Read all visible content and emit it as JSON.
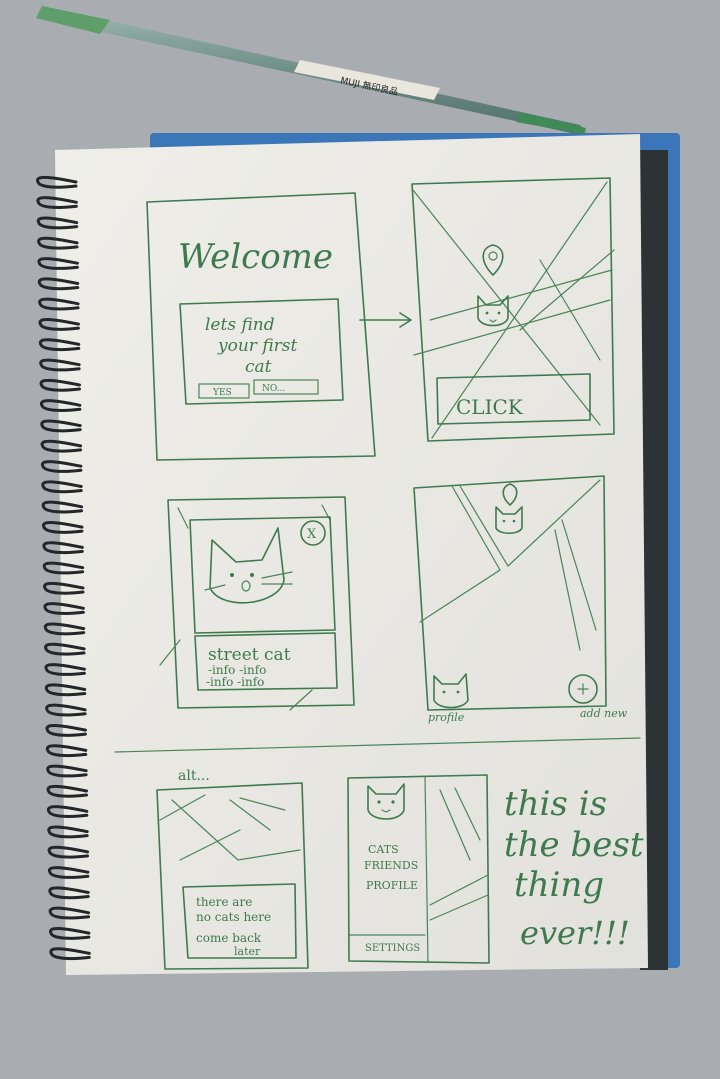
{
  "pen": {
    "brand": "MUJI 無印良品"
  },
  "frame1": {
    "title": "Welcome",
    "dialog": [
      "lets find",
      "your first",
      "cat"
    ],
    "yes_label": "YES",
    "no_label": "NO..."
  },
  "frame2": {
    "button_label": "CLICK"
  },
  "frame3": {
    "close_label": "X",
    "card_title": "street cat",
    "info_row1": "-info -info",
    "info_row2": "-info -info"
  },
  "frame4": {
    "profile_label": "profile",
    "add_label": "add new"
  },
  "alt_label": "alt...",
  "frame5": {
    "message": [
      "there are",
      "no cats here",
      "come back",
      "later"
    ]
  },
  "frame6": {
    "menu_items": [
      "CATS",
      "FRIENDS",
      "PROFILE"
    ],
    "settings_label": "SETTINGS"
  },
  "note": [
    "this is",
    "the best",
    "thing",
    "ever!!!"
  ],
  "colors": {
    "ink": "#3f7a4f",
    "paper": "#ecebe6",
    "background": "#a9adb2",
    "cover": "#3a76b8"
  }
}
